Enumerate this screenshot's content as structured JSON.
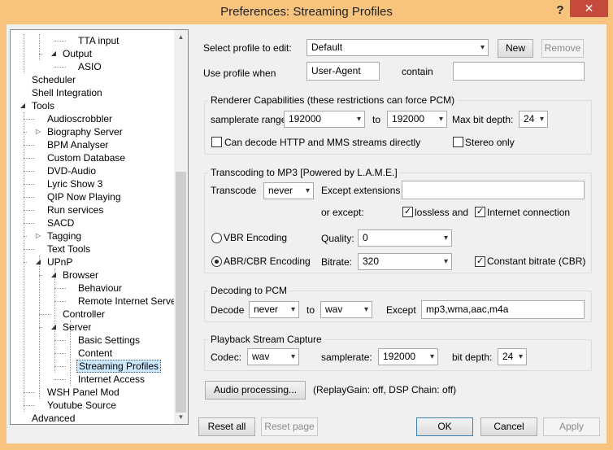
{
  "window": {
    "title": "Preferences: Streaming Profiles",
    "help_glyph": "?",
    "close_glyph": "✕"
  },
  "tree": {
    "items": [
      {
        "label": "TTA input"
      },
      {
        "label": "Output",
        "expander": "◢"
      },
      {
        "label": "ASIO"
      },
      {
        "label": "Scheduler"
      },
      {
        "label": "Shell Integration"
      },
      {
        "label": "Tools",
        "expander": "◢"
      },
      {
        "label": "Audioscrobbler"
      },
      {
        "label": "Biography Server",
        "expander": "▷"
      },
      {
        "label": "BPM Analyser"
      },
      {
        "label": "Custom Database"
      },
      {
        "label": "DVD-Audio"
      },
      {
        "label": "Lyric Show 3"
      },
      {
        "label": "QIP Now Playing"
      },
      {
        "label": "Run services"
      },
      {
        "label": "SACD"
      },
      {
        "label": "Tagging",
        "expander": "▷"
      },
      {
        "label": "Text Tools"
      },
      {
        "label": "UPnP",
        "expander": "◢"
      },
      {
        "label": "Browser",
        "expander": "◢"
      },
      {
        "label": "Behaviour"
      },
      {
        "label": "Remote Internet Servers"
      },
      {
        "label": "Controller"
      },
      {
        "label": "Server",
        "expander": "◢"
      },
      {
        "label": "Basic Settings"
      },
      {
        "label": "Content"
      },
      {
        "label": "Streaming Profiles",
        "selected": true
      },
      {
        "label": "Internet Access"
      },
      {
        "label": "WSH Panel Mod"
      },
      {
        "label": "Youtube Source"
      },
      {
        "label": "Advanced"
      }
    ],
    "scroll_up": "▲",
    "scroll_down": "▼"
  },
  "profile": {
    "select_label": "Select profile to edit:",
    "selected": "Default",
    "new_button": "New",
    "remove_button": "Remove",
    "use_when_label": "Use profile when",
    "use_when_value": "User-Agent",
    "contain_label": "contain",
    "contain_value": ""
  },
  "renderer": {
    "title": "Renderer Capabilities (these restrictions can force PCM)",
    "samplerate_label": "samplerate range:",
    "rate_from": "192000",
    "to_label": "to",
    "rate_to": "192000",
    "bitdepth_label": "Max bit depth:",
    "bitdepth": "24",
    "http_mms_label": "Can decode  HTTP and MMS  streams directly",
    "http_mms_checked": false,
    "stereo_label": "Stereo only",
    "stereo_checked": false
  },
  "transcoding": {
    "title": "Transcoding to MP3 [Powered by L.A.M.E.]",
    "transcode_label": "Transcode",
    "transcode_value": "never",
    "except_ext_label": "Except extensions",
    "except_ext_value": "",
    "or_except_label": "or except:",
    "lossless_label": "lossless and",
    "lossless_checked": true,
    "internet_label": "Internet connection",
    "internet_checked": true,
    "vbr_label": "VBR Encoding",
    "vbr_selected": false,
    "quality_label": "Quality:",
    "quality_value": "0",
    "abr_label": "ABR/CBR Encoding",
    "abr_selected": true,
    "bitrate_label": "Bitrate:",
    "bitrate_value": "320",
    "cbr_label": "Constant bitrate (CBR)",
    "cbr_checked": true
  },
  "decoding": {
    "title": "Decoding to PCM",
    "decode_label": "Decode",
    "decode_value": "never",
    "to_label": "to",
    "to_value": "wav",
    "except_label": "Except",
    "except_value": "mp3,wma,aac,m4a"
  },
  "capture": {
    "title": "Playback Stream Capture",
    "codec_label": "Codec:",
    "codec_value": "wav",
    "samplerate_label": "samplerate:",
    "samplerate_value": "192000",
    "bitdepth_label": "bit depth:",
    "bitdepth_value": "24"
  },
  "audio": {
    "button": "Audio processing...",
    "status": "(ReplayGain: off, DSP Chain: off)"
  },
  "footer": {
    "reset_all": "Reset all",
    "reset_page": "Reset page",
    "ok": "OK",
    "cancel": "Cancel",
    "apply": "Apply"
  },
  "icons": {
    "combo_arrow": "▾",
    "check_mark": "✓"
  }
}
